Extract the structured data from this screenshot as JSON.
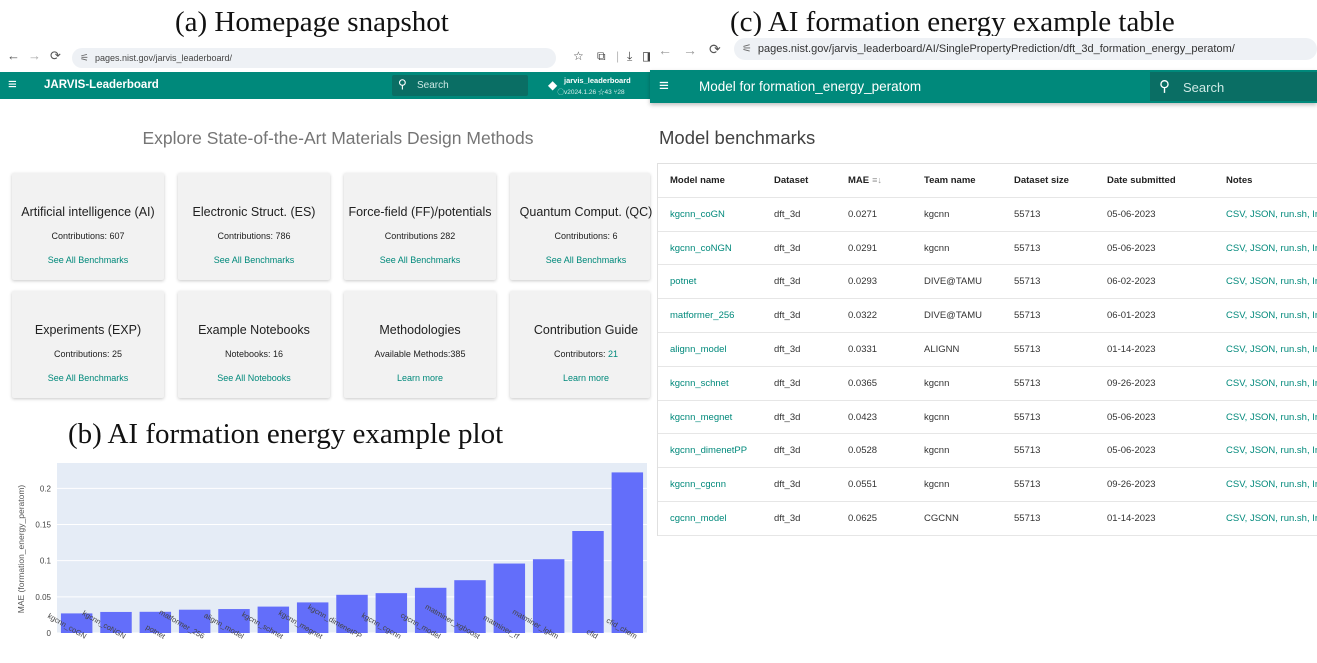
{
  "captions": {
    "a": "(a) Homepage snapshot",
    "b": "(b) AI formation energy example plot",
    "c": "(c) AI formation energy example table"
  },
  "homepage": {
    "url": "pages.nist.gov/jarvis_leaderboard/",
    "brand": "JARVIS-Leaderboard",
    "search_placeholder": "Search",
    "repo_name": "jarvis_leaderboard",
    "repo_meta": "⃝v2024.1.26 ☆43 ⑂28",
    "headline": "Explore State-of-the-Art Materials Design Methods",
    "cards": [
      {
        "title": "Artificial intelligence (AI)",
        "count_text": "Contributions: 607",
        "link": "See All Benchmarks"
      },
      {
        "title": "Electronic Struct. (ES)",
        "count_text": "Contributions: 786",
        "link": "See All Benchmarks"
      },
      {
        "title": "Force-field (FF)/potentials",
        "count_text": "Contributions 282",
        "link": "See All Benchmarks"
      },
      {
        "title": "Quantum Comput. (QC)",
        "count_text": "Contributions: 6",
        "link": "See All Benchmarks"
      },
      {
        "title": "Experiments (EXP)",
        "count_text": "Contributions: 25",
        "link": "See All Benchmarks"
      },
      {
        "title": "Example Notebooks",
        "count_text": "Notebooks: 16",
        "link": "See All Notebooks"
      },
      {
        "title": "Methodologies",
        "count_text": "Available Methods:385",
        "link": "Learn more"
      },
      {
        "title": "Contribution Guide",
        "count_text": "Contributors: ",
        "count_highlight": "21",
        "link": "Learn more"
      }
    ]
  },
  "chart_data": {
    "type": "bar",
    "ylabel": "MAE (formation_energy_peratom)",
    "ylim": [
      0,
      0.235
    ],
    "yticks": [
      0,
      0.05,
      0.1,
      0.15,
      0.2
    ],
    "ytick_labels": [
      "0",
      "0.05",
      "0.1",
      "0.15",
      "0.2"
    ],
    "grid": true,
    "bar_color": "#636efa",
    "plot_bg": "#e5ecf6",
    "categories": [
      "kgcnn_coGN",
      "kgcnn_coNGN",
      "potnet",
      "matformer_256",
      "alignn_model",
      "kgcnn_schnet",
      "kgcnn_megnet",
      "kgcnn_dimenetPP",
      "kgcnn_cgcnn",
      "cgcnn_model",
      "matminer_xgboost",
      "matminer_rf",
      "matminer_lgbm",
      "cfid",
      "cfid_chem"
    ],
    "values": [
      0.0271,
      0.0291,
      0.0293,
      0.0322,
      0.0331,
      0.0365,
      0.0423,
      0.0528,
      0.0551,
      0.0625,
      0.073,
      0.096,
      0.102,
      0.141,
      0.222
    ]
  },
  "table_page": {
    "url": "pages.nist.gov/jarvis_leaderboard/AI/SinglePropertyPrediction/dft_3d_formation_energy_peratom/",
    "appbar_title": "Model for formation_energy_peratom",
    "search_placeholder": "Search",
    "heading": "Model benchmarks",
    "columns": [
      "Model name",
      "Dataset",
      "MAE",
      "Team name",
      "Dataset size",
      "Date submitted",
      "Notes"
    ],
    "sort_icon": "≡↓",
    "rows": [
      [
        "kgcnn_coGN",
        "dft_3d",
        "0.0271",
        "kgcnn",
        "55713",
        "05-06-2023",
        "CSV, JSON, run.sh, Info"
      ],
      [
        "kgcnn_coNGN",
        "dft_3d",
        "0.0291",
        "kgcnn",
        "55713",
        "05-06-2023",
        "CSV, JSON, run.sh, Info"
      ],
      [
        "potnet",
        "dft_3d",
        "0.0293",
        "DIVE@TAMU",
        "55713",
        "06-02-2023",
        "CSV, JSON, run.sh, Info"
      ],
      [
        "matformer_256",
        "dft_3d",
        "0.0322",
        "DIVE@TAMU",
        "55713",
        "06-01-2023",
        "CSV, JSON, run.sh, Info"
      ],
      [
        "alignn_model",
        "dft_3d",
        "0.0331",
        "ALIGNN",
        "55713",
        "01-14-2023",
        "CSV, JSON, run.sh, Info"
      ],
      [
        "kgcnn_schnet",
        "dft_3d",
        "0.0365",
        "kgcnn",
        "55713",
        "09-26-2023",
        "CSV, JSON, run.sh, Info"
      ],
      [
        "kgcnn_megnet",
        "dft_3d",
        "0.0423",
        "kgcnn",
        "55713",
        "05-06-2023",
        "CSV, JSON, run.sh, Info"
      ],
      [
        "kgcnn_dimenetPP",
        "dft_3d",
        "0.0528",
        "kgcnn",
        "55713",
        "05-06-2023",
        "CSV, JSON, run.sh, Info"
      ],
      [
        "kgcnn_cgcnn",
        "dft_3d",
        "0.0551",
        "kgcnn",
        "55713",
        "09-26-2023",
        "CSV, JSON, run.sh, Info"
      ],
      [
        "cgcnn_model",
        "dft_3d",
        "0.0625",
        "CGCNN",
        "55713",
        "01-14-2023",
        "CSV, JSON, run.sh, Info"
      ]
    ]
  }
}
